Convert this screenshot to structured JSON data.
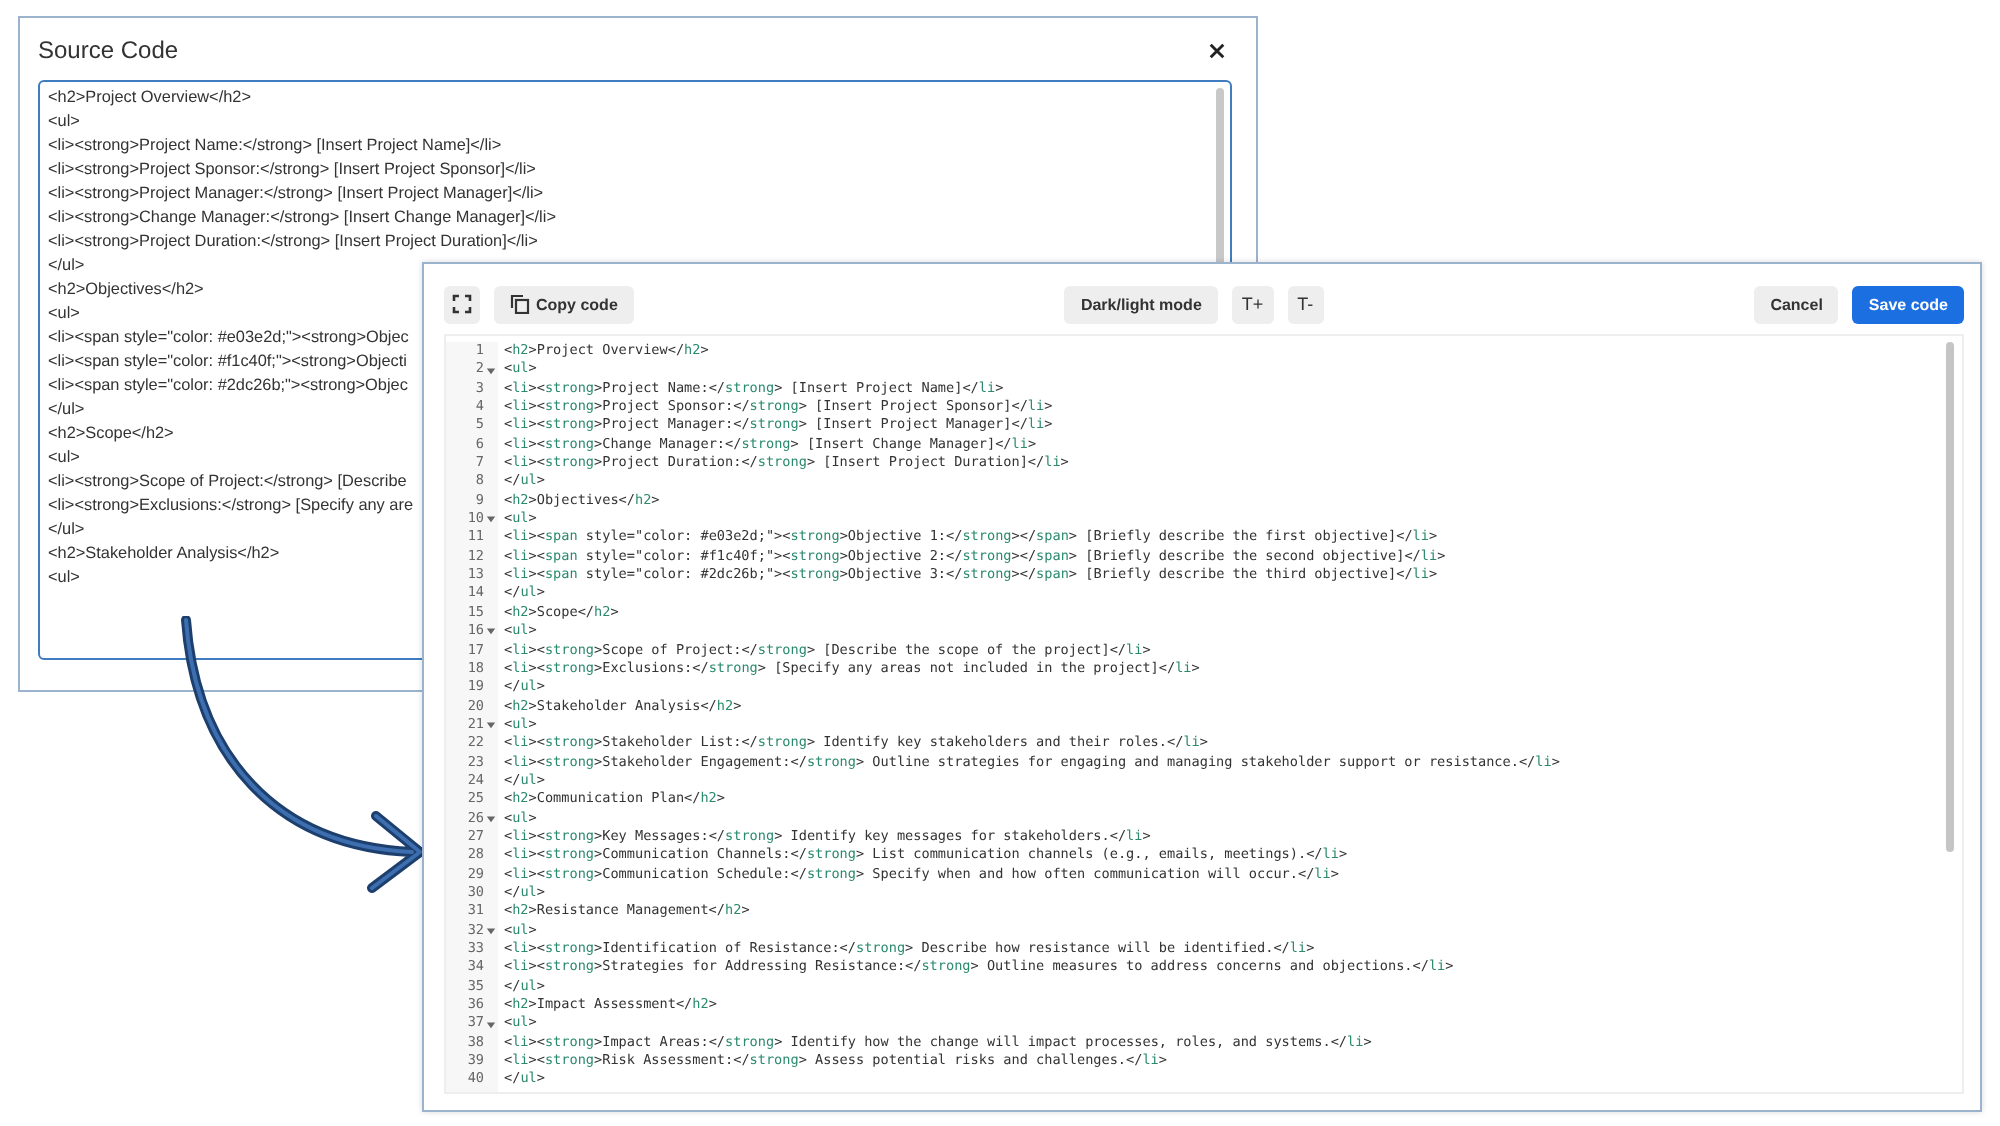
{
  "source_dialog": {
    "title": "Source Code",
    "lines": [
      "<h2>Project Overview</h2>",
      "<ul>",
      "<li><strong>Project Name:</strong> [Insert Project Name]</li>",
      "<li><strong>Project Sponsor:</strong> [Insert Project Sponsor]</li>",
      "<li><strong>Project Manager:</strong> [Insert Project Manager]</li>",
      "<li><strong>Change Manager:</strong> [Insert Change Manager]</li>",
      "<li><strong>Project Duration:</strong> [Insert Project Duration]</li>",
      "</ul>",
      "<h2>Objectives</h2>",
      "<ul>",
      "<li><span style=\"color: #e03e2d;\"><strong>Objec",
      "<li><span style=\"color: #f1c40f;\"><strong>Objecti",
      "<li><span style=\"color: #2dc26b;\"><strong>Objec",
      "</ul>",
      "<h2>Scope</h2>",
      "<ul>",
      "<li><strong>Scope of Project:</strong> [Describe",
      "<li><strong>Exclusions:</strong> [Specify any are",
      "</ul>",
      "<h2>Stakeholder Analysis</h2>",
      "<ul>"
    ]
  },
  "code_editor": {
    "toolbar": {
      "copy": "Copy code",
      "theme": "Dark/light mode",
      "font_up": "T+",
      "font_down": "T-",
      "cancel": "Cancel",
      "save": "Save code"
    },
    "lines": [
      {
        "n": "1",
        "foldable": false,
        "code": "<h2>Project Overview</h2>"
      },
      {
        "n": "2",
        "foldable": true,
        "code": "<ul>"
      },
      {
        "n": "3",
        "foldable": false,
        "code": "<li><strong>Project Name:</strong> [Insert Project Name]</li>"
      },
      {
        "n": "4",
        "foldable": false,
        "code": "<li><strong>Project Sponsor:</strong> [Insert Project Sponsor]</li>"
      },
      {
        "n": "5",
        "foldable": false,
        "code": "<li><strong>Project Manager:</strong> [Insert Project Manager]</li>"
      },
      {
        "n": "6",
        "foldable": false,
        "code": "<li><strong>Change Manager:</strong> [Insert Change Manager]</li>"
      },
      {
        "n": "7",
        "foldable": false,
        "code": "<li><strong>Project Duration:</strong> [Insert Project Duration]</li>"
      },
      {
        "n": "8",
        "foldable": false,
        "code": "</ul>"
      },
      {
        "n": "9",
        "foldable": false,
        "code": "<h2>Objectives</h2>"
      },
      {
        "n": "10",
        "foldable": true,
        "code": "<ul>"
      },
      {
        "n": "11",
        "foldable": false,
        "code": "<li><span style=\"color: #e03e2d;\"><strong>Objective 1:</strong></span> [Briefly describe the first objective]</li>"
      },
      {
        "n": "12",
        "foldable": false,
        "code": "<li><span style=\"color: #f1c40f;\"><strong>Objective 2:</strong></span> [Briefly describe the second objective]</li>"
      },
      {
        "n": "13",
        "foldable": false,
        "code": "<li><span style=\"color: #2dc26b;\"><strong>Objective 3:</strong></span> [Briefly describe the third objective]</li>"
      },
      {
        "n": "14",
        "foldable": false,
        "code": "</ul>"
      },
      {
        "n": "15",
        "foldable": false,
        "code": "<h2>Scope</h2>"
      },
      {
        "n": "16",
        "foldable": true,
        "code": "<ul>"
      },
      {
        "n": "17",
        "foldable": false,
        "code": "<li><strong>Scope of Project:</strong> [Describe the scope of the project]</li>"
      },
      {
        "n": "18",
        "foldable": false,
        "code": "<li><strong>Exclusions:</strong> [Specify any areas not included in the project]</li>"
      },
      {
        "n": "19",
        "foldable": false,
        "code": "</ul>"
      },
      {
        "n": "20",
        "foldable": false,
        "code": "<h2>Stakeholder Analysis</h2>"
      },
      {
        "n": "21",
        "foldable": true,
        "code": "<ul>"
      },
      {
        "n": "22",
        "foldable": false,
        "code": "<li><strong>Stakeholder List:</strong> Identify key stakeholders and their roles.</li>"
      },
      {
        "n": "23",
        "foldable": false,
        "code": "<li><strong>Stakeholder Engagement:</strong> Outline strategies for engaging and managing stakeholder support or resistance.</li>"
      },
      {
        "n": "24",
        "foldable": false,
        "code": "</ul>"
      },
      {
        "n": "25",
        "foldable": false,
        "code": "<h2>Communication Plan</h2>"
      },
      {
        "n": "26",
        "foldable": true,
        "code": "<ul>"
      },
      {
        "n": "27",
        "foldable": false,
        "code": "<li><strong>Key Messages:</strong> Identify key messages for stakeholders.</li>"
      },
      {
        "n": "28",
        "foldable": false,
        "code": "<li><strong>Communication Channels:</strong> List communication channels (e.g., emails, meetings).</li>"
      },
      {
        "n": "29",
        "foldable": false,
        "code": "<li><strong>Communication Schedule:</strong> Specify when and how often communication will occur.</li>"
      },
      {
        "n": "30",
        "foldable": false,
        "code": "</ul>"
      },
      {
        "n": "31",
        "foldable": false,
        "code": "<h2>Resistance Management</h2>"
      },
      {
        "n": "32",
        "foldable": true,
        "code": "<ul>"
      },
      {
        "n": "33",
        "foldable": false,
        "code": "<li><strong>Identification of Resistance:</strong> Describe how resistance will be identified.</li>"
      },
      {
        "n": "34",
        "foldable": false,
        "code": "<li><strong>Strategies for Addressing Resistance:</strong> Outline measures to address concerns and objections.</li>"
      },
      {
        "n": "35",
        "foldable": false,
        "code": "</ul>"
      },
      {
        "n": "36",
        "foldable": false,
        "code": "<h2>Impact Assessment</h2>"
      },
      {
        "n": "37",
        "foldable": true,
        "code": "<ul>"
      },
      {
        "n": "38",
        "foldable": false,
        "code": "<li><strong>Impact Areas:</strong> Identify how the change will impact processes, roles, and systems.</li>"
      },
      {
        "n": "39",
        "foldable": false,
        "code": "<li><strong>Risk Assessment:</strong> Assess potential risks and challenges.</li>"
      },
      {
        "n": "40",
        "foldable": false,
        "code": "</ul>"
      }
    ]
  }
}
